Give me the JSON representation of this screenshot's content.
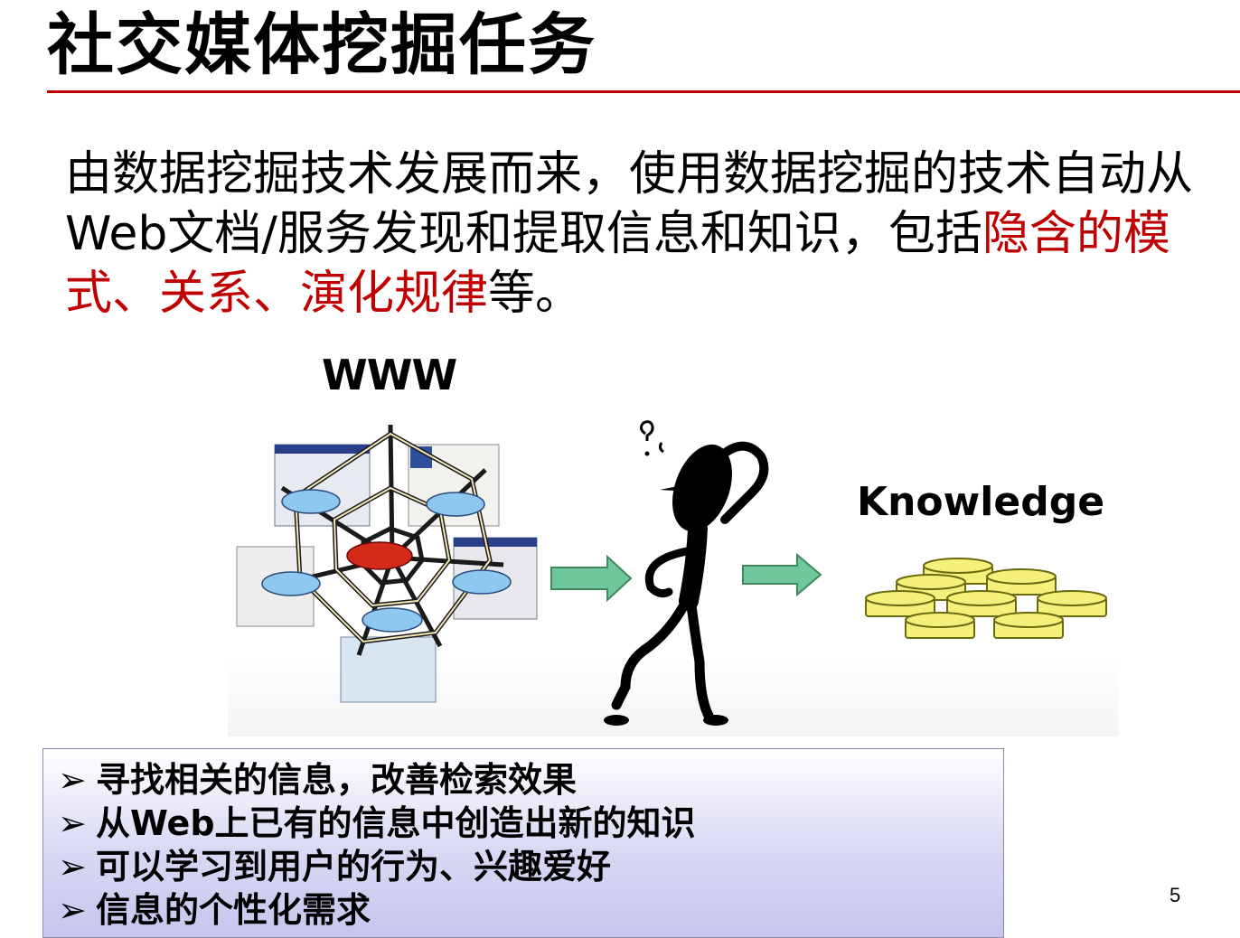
{
  "title": "社交媒体挖掘任务",
  "intro": {
    "text_before": "由数据挖掘技术发展而来，使用数据挖掘的技术自动从Web文档/服务发现和提取信息和知识，包括",
    "highlight": "隐含的模式、关系、演化规律",
    "text_after": "等。"
  },
  "diagram": {
    "www_label": "WWW",
    "knowledge_label": "Knowledge"
  },
  "bullets": {
    "marker": "➢",
    "items": [
      "寻找相关的信息，改善检索效果",
      "从Web上已有的信息中创造出新的知识",
      "可以学习到用户的行为、兴趣爱好",
      "信息的个性化需求"
    ]
  },
  "page_number": "5",
  "colors": {
    "accent_red": "#c00000",
    "arrow_green": "#6fc79a",
    "coin_yellow": "#f4f07a",
    "node_blue": "#8ec8f0",
    "center_node_red": "#d42a1a"
  }
}
